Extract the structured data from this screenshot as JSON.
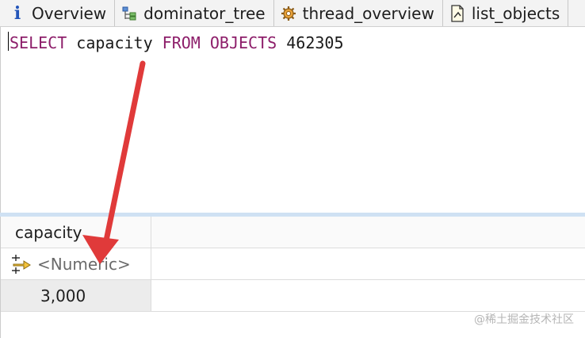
{
  "tabs": [
    {
      "label": "Overview",
      "icon": "info-icon"
    },
    {
      "label": "dominator_tree",
      "icon": "tree-icon"
    },
    {
      "label": "thread_overview",
      "icon": "gear-icon"
    },
    {
      "label": "list_objects",
      "icon": "document-icon"
    }
  ],
  "editor": {
    "tokens": {
      "select": "SELECT",
      "field": "capacity",
      "from": "FROM",
      "objects": "OBJECTS",
      "id": "462305"
    }
  },
  "grid": {
    "column_header": "capacity",
    "filter_placeholder": "<Numeric>",
    "rows": [
      {
        "capacity": "3,000"
      }
    ]
  },
  "watermark": "@稀土掘金技术社区",
  "colors": {
    "keyword": "#8d1e6a",
    "arrow": "#e03a3a",
    "splitter": "#cfe1f3"
  }
}
